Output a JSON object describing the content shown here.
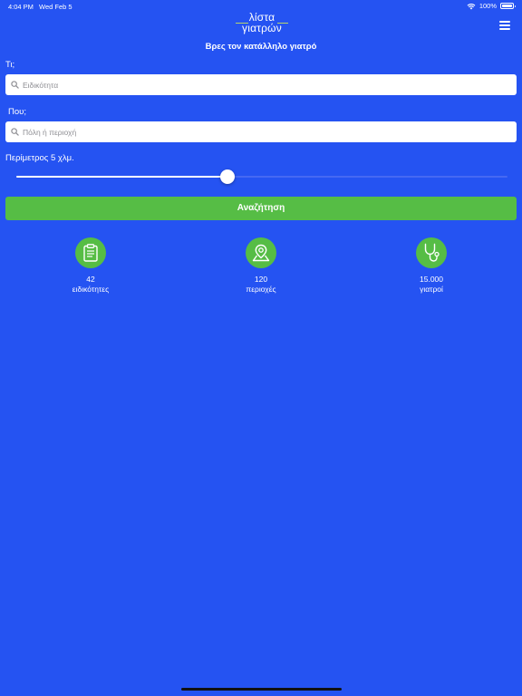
{
  "status_bar": {
    "time": "4:04 PM",
    "date": "Wed Feb 5",
    "battery": "100%"
  },
  "nav": {
    "logo_line1": "λίστα",
    "logo_line2": "γιατρών"
  },
  "page_title": "Βρες τον κατάλληλο γιατρό",
  "what": {
    "label": "Τι;",
    "placeholder": "Ειδικότητα",
    "value": ""
  },
  "where": {
    "label": "Που;",
    "placeholder": "Πόλη ή περιοχή",
    "value": ""
  },
  "radius": {
    "label": "Περίμετρος 5 χλμ.",
    "fraction": 0.43
  },
  "search_button": "Αναζήτηση",
  "stats": [
    {
      "icon": "clipboard-icon",
      "value": "42",
      "label": "ειδικότητες"
    },
    {
      "icon": "map-pin-icon",
      "value": "120",
      "label": "περιοχές"
    },
    {
      "icon": "stethoscope-icon",
      "value": "15.000",
      "label": "γιατροί"
    }
  ],
  "colors": {
    "background": "#2553f2",
    "accent": "#56bd45",
    "logo_accent": "#b7d56c"
  }
}
